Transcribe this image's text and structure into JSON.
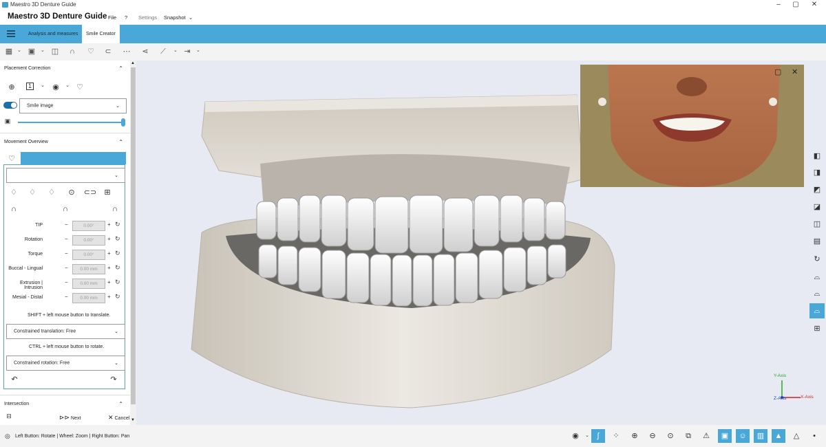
{
  "window": {
    "title": "Maestro 3D Denture Guide",
    "controls": [
      "–",
      "▢",
      "✕"
    ]
  },
  "menubar": {
    "app_title": "Maestro 3D Denture Guide",
    "items": [
      "File",
      "?",
      "Settings",
      "Snapshot"
    ]
  },
  "ribbon": {
    "tabs": [
      {
        "label": "Analysis and measures",
        "active": false
      },
      {
        "label": "Smile Creator",
        "active": true
      }
    ]
  },
  "toolbar": {
    "icons": [
      "smile-image-icon",
      "face-image-icon",
      "screen-select-icon",
      "arch-icon",
      "tooth-icon",
      "gum-icon",
      "dentition-icon",
      "tree-icon",
      "chart-icon",
      "export-icon"
    ]
  },
  "placement": {
    "header": "Placement Correction",
    "smile_dropdown": "Smile image",
    "slider_value": 1.0
  },
  "movement": {
    "header": "Movement Overview",
    "rows": [
      {
        "label": "TIP",
        "value": "0.00°"
      },
      {
        "label": "Rotation",
        "value": "0.00°"
      },
      {
        "label": "Torque",
        "value": "0.00°"
      },
      {
        "label": "Buccal - Lingual",
        "value": "0.00 mm"
      },
      {
        "label": "Extrusion | Intrusion",
        "value": "0.00 mm"
      },
      {
        "label": "Mesial - Distal",
        "value": "0.00 mm"
      }
    ],
    "shift_hint": "SHIFT + left mouse button to translate.",
    "constrained_translation": "Constrained translation: Free",
    "ctrl_hint": "CTRL + left mouse button to rotate.",
    "constrained_rotation": "Constrained rotation: Free",
    "minus": "−",
    "plus": "+"
  },
  "intersection": {
    "header": "Intersection"
  },
  "actions": {
    "next": "Next",
    "cancel": "Cancel"
  },
  "axes": {
    "y": "Y-Axis",
    "z": "Z-Axis",
    "x": "X-Axis"
  },
  "statusbar": {
    "hint": "Left Button: Rotate | Wheel: Zoom | Right Button: Pan"
  },
  "colors": {
    "accent": "#4aa8d8",
    "toggle": "#1d6fa8",
    "model": "#d9d3cb",
    "teeth": "#f4f4f4"
  }
}
